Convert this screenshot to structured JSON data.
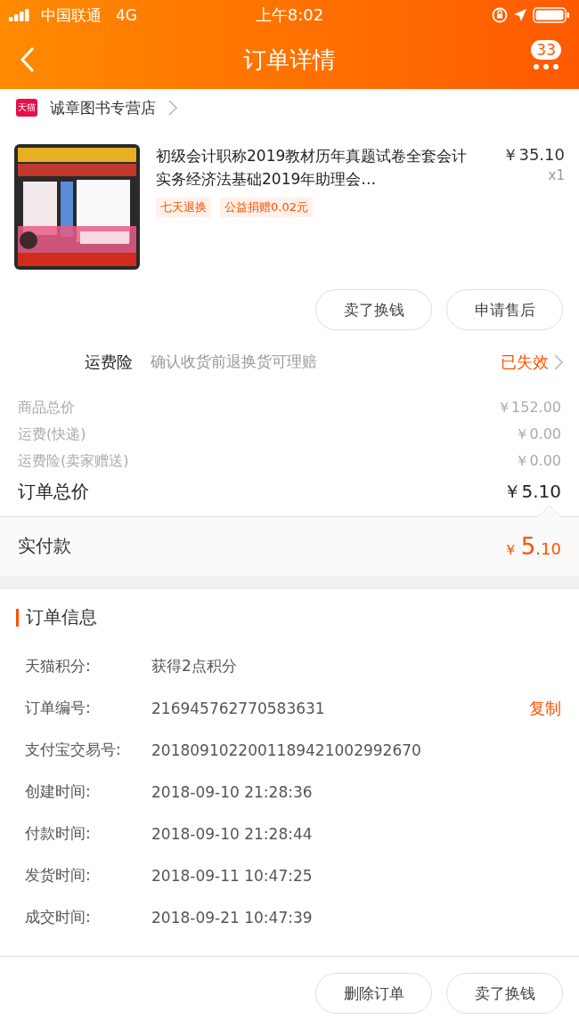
{
  "status_bar": {
    "carrier": "中国联通",
    "network": "4G",
    "time": "上午8:02"
  },
  "nav": {
    "title": "订单详情",
    "badge": "33"
  },
  "store": {
    "name": "诚章图书专营店",
    "logo": "天猫"
  },
  "product": {
    "kind": "picture",
    "title": "初级会计职称2019教材历年真题试卷全套会计实务经济法基础2019年助理会…",
    "price": "￥35.10",
    "quantity": "x1",
    "tags": [
      "七天退换",
      "公益捐赠0.02元"
    ]
  },
  "item_buttons": [
    "卖了换钱",
    "申请售后"
  ],
  "insurance": {
    "label": "运费险",
    "description": "确认收货前退换货可理赔",
    "status": "已失效"
  },
  "costs": [
    {
      "label": "商品总价",
      "value": "￥152.00",
      "kind": "minor"
    },
    {
      "label": "运费(快递)",
      "value": "￥0.00",
      "kind": "minor"
    },
    {
      "label": "运费险(卖家赠送)",
      "value": "￥0.00",
      "kind": "minor"
    },
    {
      "label": "订单总价",
      "value": "￥5.10",
      "kind": "total"
    }
  ],
  "payment": {
    "label": "实付款",
    "currency": "￥",
    "integer": "5",
    "decimal": ".10"
  },
  "order_info": {
    "title": "订单信息",
    "rows": [
      {
        "label": "天猫积分:",
        "value": "获得2点积分"
      },
      {
        "label": "订单编号:",
        "value": "216945762770583631",
        "action": "复制"
      },
      {
        "label": "支付宝交易号:",
        "value": "2018091022001189421002992670"
      },
      {
        "label": "创建时间:",
        "value": "2018-09-10 21:28:36"
      },
      {
        "label": "付款时间:",
        "value": "2018-09-10 21:28:44"
      },
      {
        "label": "发货时间:",
        "value": "2018-09-11 10:47:25"
      },
      {
        "label": "成交时间:",
        "value": "2018-09-21 10:47:39"
      }
    ]
  },
  "bottom_buttons": [
    "删除订单",
    "卖了换钱"
  ]
}
